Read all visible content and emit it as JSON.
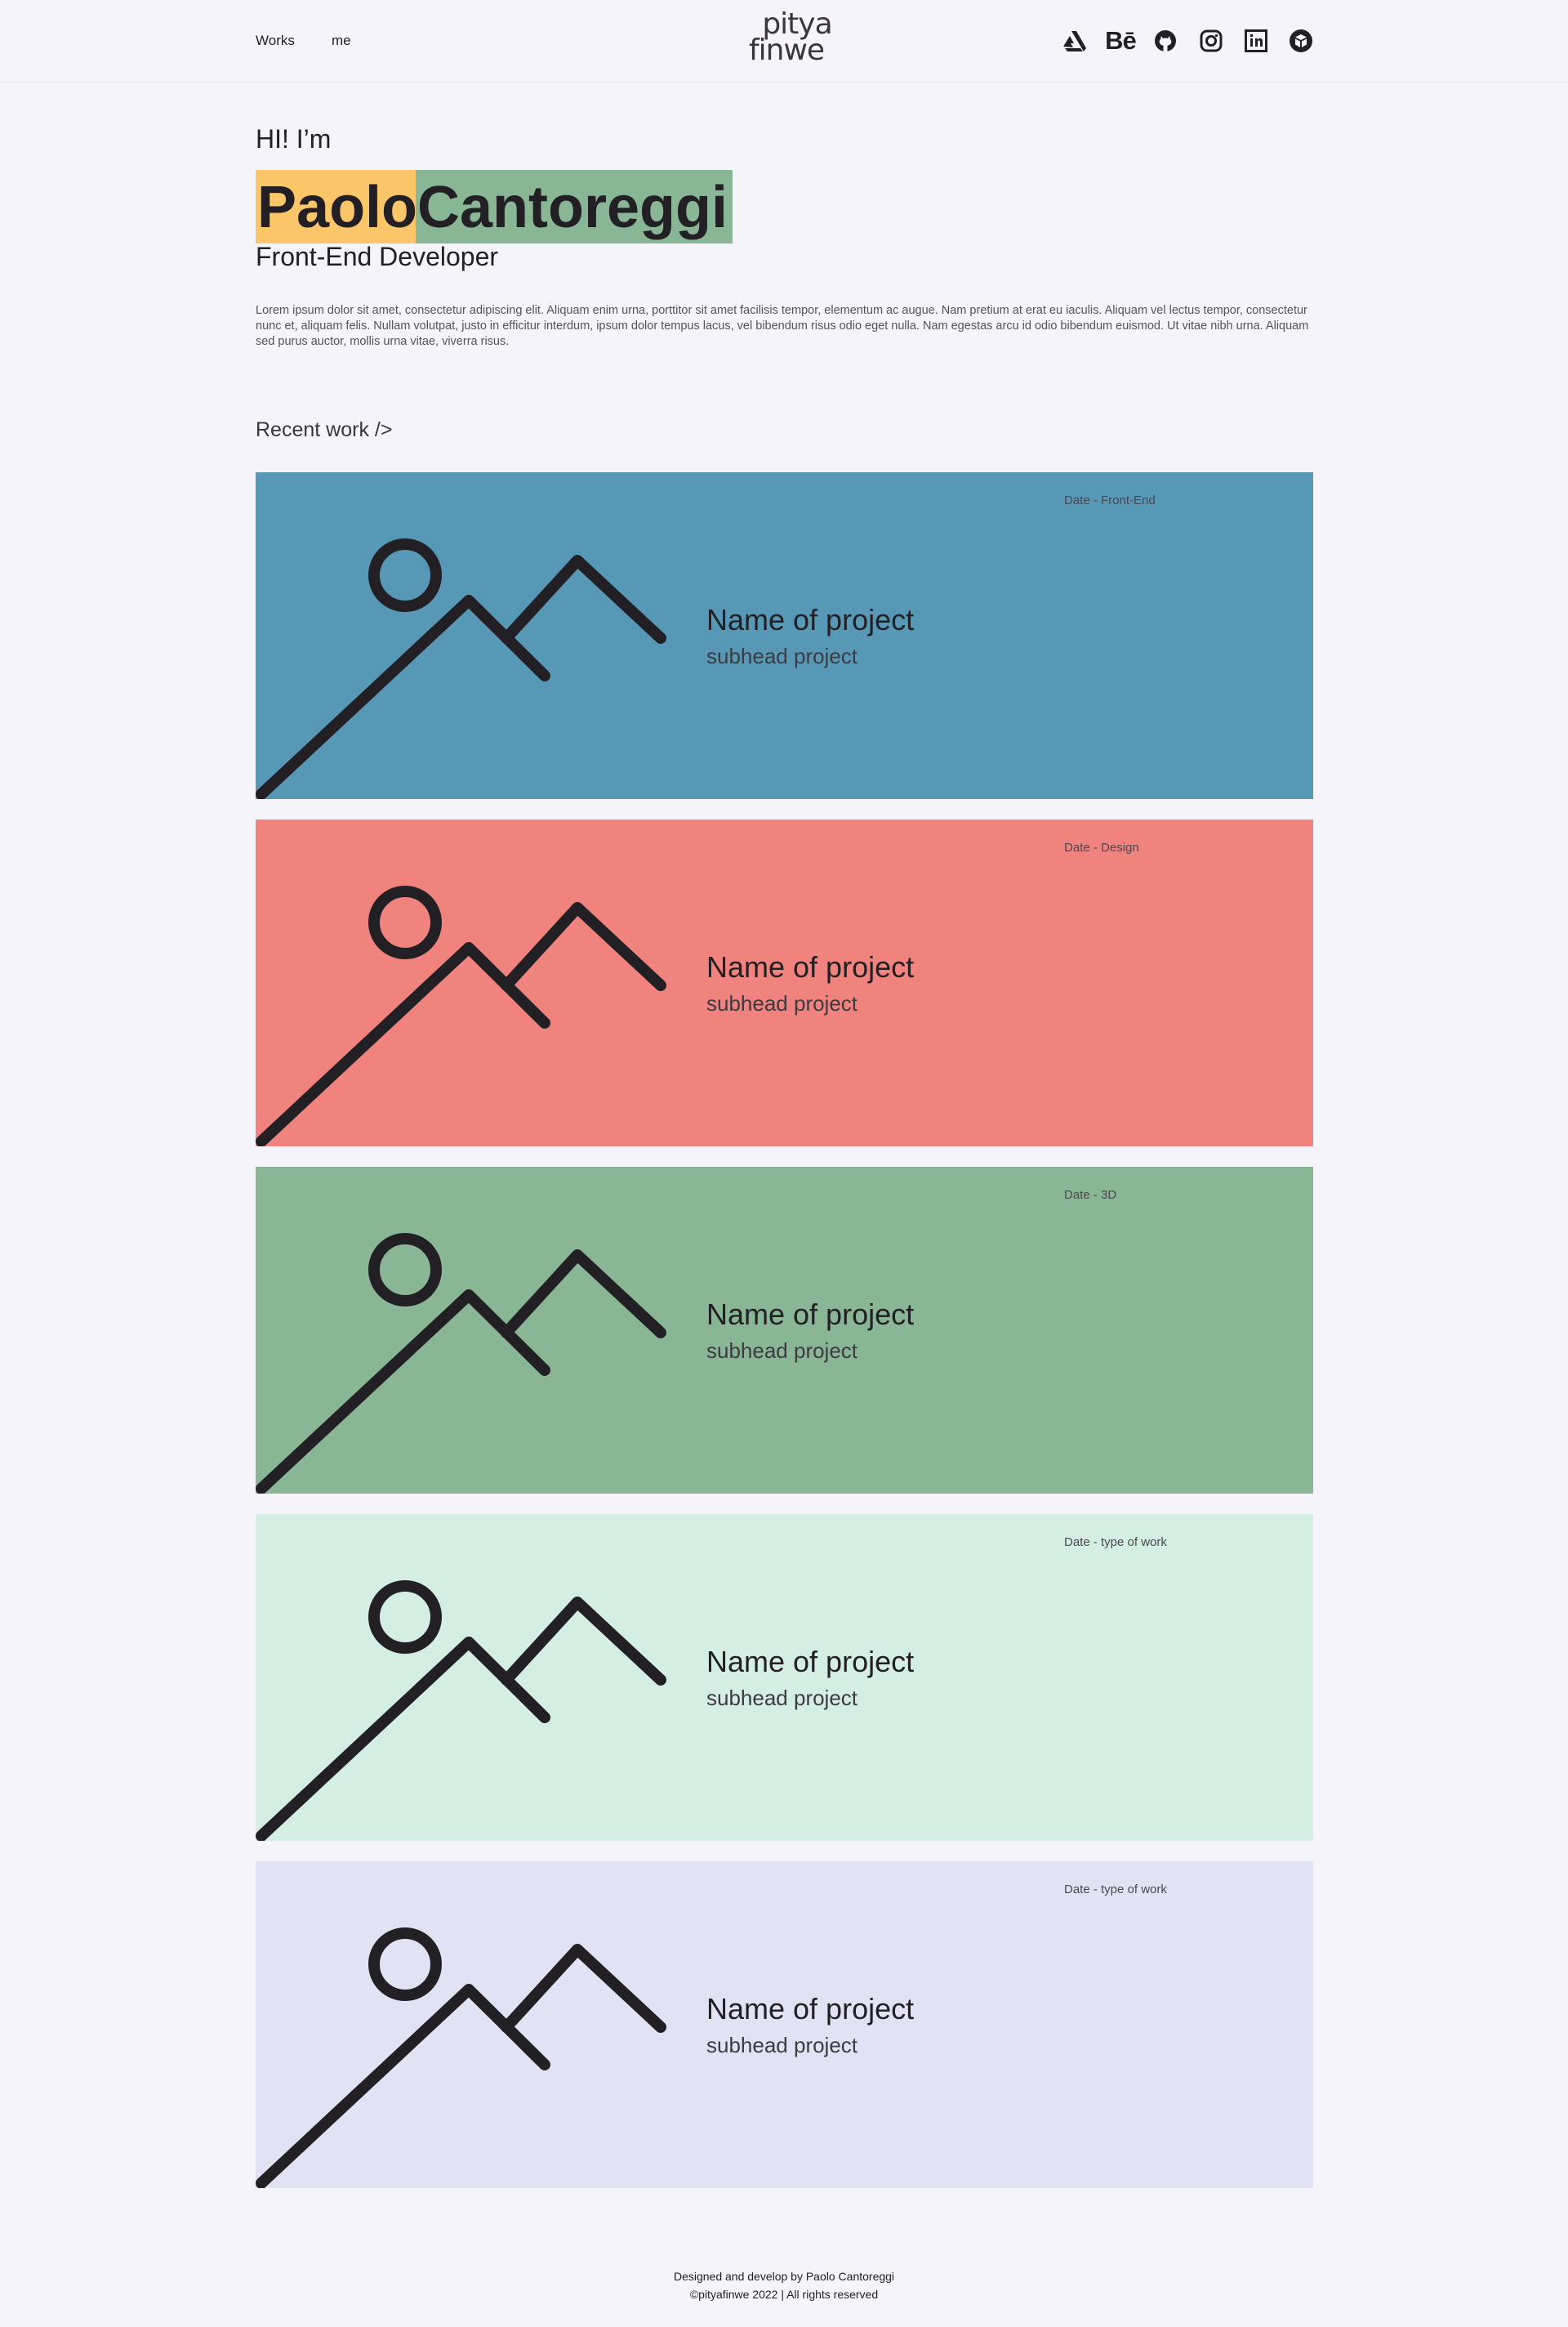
{
  "header": {
    "nav": [
      {
        "label": "Works"
      },
      {
        "label": "me"
      }
    ],
    "logo": {
      "line1": "pitya",
      "line2": "finwe"
    },
    "social": [
      {
        "icon": "artstation-icon"
      },
      {
        "icon": "behance-icon",
        "label": "Bē"
      },
      {
        "icon": "github-icon"
      },
      {
        "icon": "instagram-icon"
      },
      {
        "icon": "linkedin-icon",
        "label": "in"
      },
      {
        "icon": "sketchfab-icon"
      }
    ]
  },
  "hero": {
    "greeting": "HI! I’m",
    "first_name": "Paolo",
    "last_name": "Cantoreggi",
    "role": "Front-End Developer",
    "intro": "Lorem ipsum dolor sit amet, consectetur adipiscing elit. Aliquam enim urna, porttitor sit amet facilisis tempor, elementum ac augue. Nam pretium at erat eu iaculis. Aliquam vel lectus tempor, consectetur nunc et, aliquam felis. Nullam volutpat, justo in efficitur interdum, ipsum dolor tempus lacus, vel bibendum risus odio eget nulla. Nam egestas arcu id odio bibendum euismod. Ut vitae nibh urna. Aliquam sed purus auctor, mollis urna vitae, viverra risus.",
    "colors": {
      "first": "#fbc569",
      "last": "#89b795"
    }
  },
  "recent": {
    "title": "Recent work />",
    "projects": [
      {
        "meta": "Date - Front-End",
        "title": "Name of project",
        "subtitle": "subhead project",
        "color": "#5898b7"
      },
      {
        "meta": "Date - Design",
        "title": "Name of project",
        "subtitle": "subhead project",
        "color": "#f0837d"
      },
      {
        "meta": "Date - 3D",
        "title": "Name of project",
        "subtitle": "subhead project",
        "color": "#89b795"
      },
      {
        "meta": "Date - type of work",
        "title": "Name of project",
        "subtitle": "subhead project",
        "color": "#d5eee4"
      },
      {
        "meta": "Date - type of work",
        "title": "Name of project",
        "subtitle": "subhead project",
        "color": "#e1e3f5"
      }
    ]
  },
  "footer": {
    "line1": "Designed and develop by Paolo Cantoreggi",
    "line2": "©pityafinwe 2022 | All rights reserved"
  }
}
